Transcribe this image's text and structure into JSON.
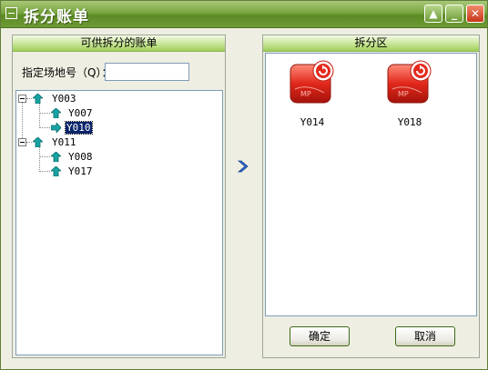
{
  "window": {
    "title": "拆分账单"
  },
  "left_panel": {
    "header": "可供拆分的账单",
    "field_label": "指定场地号（Q）：",
    "field_value": "",
    "tree": [
      {
        "label": "Y003",
        "children": [
          {
            "label": "Y007"
          },
          {
            "label": "Y010",
            "selected": true
          }
        ]
      },
      {
        "label": "Y011",
        "children": [
          {
            "label": "Y008"
          },
          {
            "label": "Y017"
          }
        ]
      }
    ]
  },
  "right_panel": {
    "header": "拆分区",
    "items": [
      {
        "label": "Y014"
      },
      {
        "label": "Y018"
      }
    ]
  },
  "buttons": {
    "ok": "确定",
    "cancel": "取消"
  }
}
